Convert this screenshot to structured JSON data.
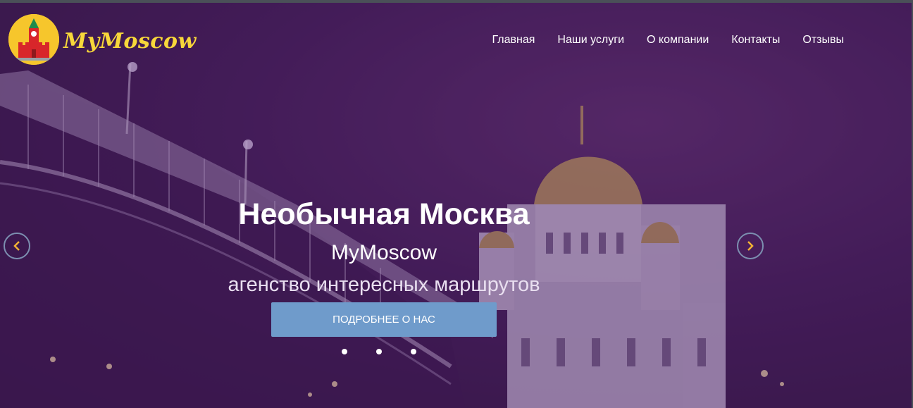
{
  "brand": {
    "name": "MyMoscow",
    "icon": "kremlin-tower-icon"
  },
  "nav": {
    "items": [
      {
        "label": "Главная"
      },
      {
        "label": "Наши услуги"
      },
      {
        "label": "О компании"
      },
      {
        "label": "Контакты"
      },
      {
        "label": "Отзывы"
      }
    ]
  },
  "hero": {
    "title": "Необычная Москва",
    "subtitle": "MyMoscow",
    "tagline": "агенство интересных маршрутов",
    "cta_label": "ПОДРОБНЕЕ О НАС",
    "prev_icon": "chevron-left-icon",
    "next_icon": "chevron-right-icon",
    "slides_count": 3
  },
  "colors": {
    "accent": "#6f9bcb",
    "brand_yellow": "#f7d73a",
    "arrow_chevron": "#f2b233"
  }
}
